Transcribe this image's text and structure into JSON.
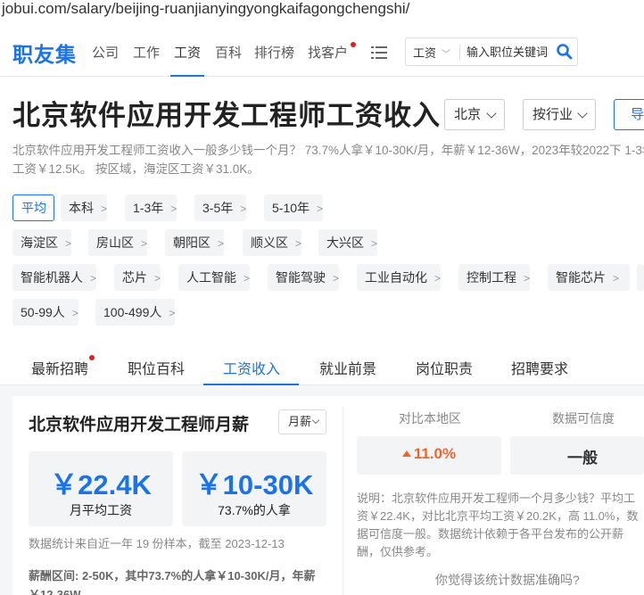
{
  "browser": {
    "url": "jobui.com/salary/beijing-ruanjianyingyongkaifagongchengshi/"
  },
  "nav": {
    "logo": "职友集",
    "items": [
      "公司",
      "工作",
      "工资",
      "百科",
      "排行榜",
      "找客户"
    ],
    "active": "工资",
    "menu_icon": "list-menu-icon",
    "search": {
      "select": "工资",
      "placeholder": "输入职位关键词",
      "icon": "search-icon"
    }
  },
  "header": {
    "title": "北京软件应用开发工程师工资收入",
    "city": "北京",
    "industry": "按行业",
    "blue_button": "导"
  },
  "summary": "北京软件应用开发工程师工资收入一般多少钱一个月？ 73.7%人拿￥10-30K/月，年薪￥12-36W，2023年较2022下 1-3年工资￥12.5K。 按区域，海淀区工资￥31.0K。",
  "tag_rows": [
    [
      "平均",
      "本科",
      "1-3年",
      "3-5年",
      "5-10年"
    ],
    [
      "海淀区",
      "房山区",
      "朝阳区",
      "顺义区",
      "大兴区"
    ],
    [
      "智能机器人",
      "芯片",
      "人工智能",
      "智能驾驶",
      "工业自动化",
      "控制工程",
      "智能芯片"
    ],
    [
      "50-99人",
      "100-499人"
    ]
  ],
  "active_tag": "平均",
  "tabs": [
    "最新招聘",
    "职位百科",
    "工资收入",
    "就业前景",
    "岗位职责",
    "招聘要求"
  ],
  "active_tab": "工资收入",
  "salary_card": {
    "title": "北京软件应用开发工程师月薪",
    "period_select": "月薪",
    "avg_value": "￥22.4K",
    "avg_label": "月平均工资",
    "range_value": "￥10-30K",
    "range_label": "73.7%的人拿",
    "stat_note": "数据统计来自近一年 19 份样本，截至 2023-12-13",
    "range_text": "薪酬区间: 2-50K，其中73.7%的人拿￥10-30K/月，年薪￥12-36W"
  },
  "compare": {
    "local_label": "对比本地区",
    "local_value": "11.0%",
    "reliability_label": "数据可信度",
    "reliability_value": "一般",
    "explanation": "说明：北京软件应用开发工程师一个月多少钱？平均工资￥22.4K，对比北京平均工资￥20.2K，高 11.0%，数据可信度一般。数据统计依赖于各平台发布的公开薪酬，仅供参考。",
    "feedback": "你觉得该统计数据准确吗?"
  },
  "colors": {
    "brand_blue": "#1a73e8",
    "up_orange": "#f0652b",
    "red_dot": "#e02020"
  }
}
